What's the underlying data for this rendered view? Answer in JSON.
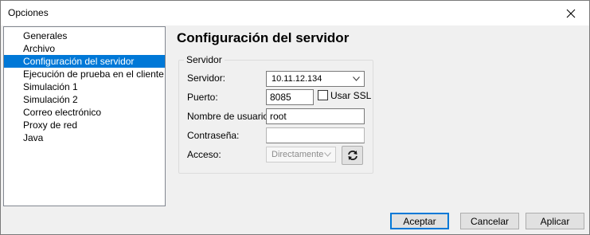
{
  "window": {
    "title": "Opciones"
  },
  "nav": {
    "items": [
      {
        "label": "Generales",
        "selected": false
      },
      {
        "label": "Archivo",
        "selected": false
      },
      {
        "label": "Configuración del servidor",
        "selected": true
      },
      {
        "label": "Ejecución de prueba en el cliente",
        "selected": false
      },
      {
        "label": "Simulación 1",
        "selected": false
      },
      {
        "label": "Simulación 2",
        "selected": false
      },
      {
        "label": "Correo electrónico",
        "selected": false
      },
      {
        "label": "Proxy de red",
        "selected": false
      },
      {
        "label": "Java",
        "selected": false
      }
    ]
  },
  "panel": {
    "title": "Configuración del servidor",
    "group_label": "Servidor",
    "server_label": "Servidor:",
    "server_value": "10.11.12.134",
    "port_label": "Puerto:",
    "port_value": "8085",
    "ssl_label": "Usar SSL",
    "ssl_checked": false,
    "user_label": "Nombre de usuario:",
    "user_value": "root",
    "password_label": "Contraseña:",
    "password_value": "",
    "access_label": "Acceso:",
    "access_value": "Directamente",
    "access_enabled": false
  },
  "footer": {
    "accept": "Aceptar",
    "cancel": "Cancelar",
    "apply": "Aplicar"
  },
  "colors": {
    "selection": "#0078d7",
    "default_button_border": "#0078d7"
  }
}
